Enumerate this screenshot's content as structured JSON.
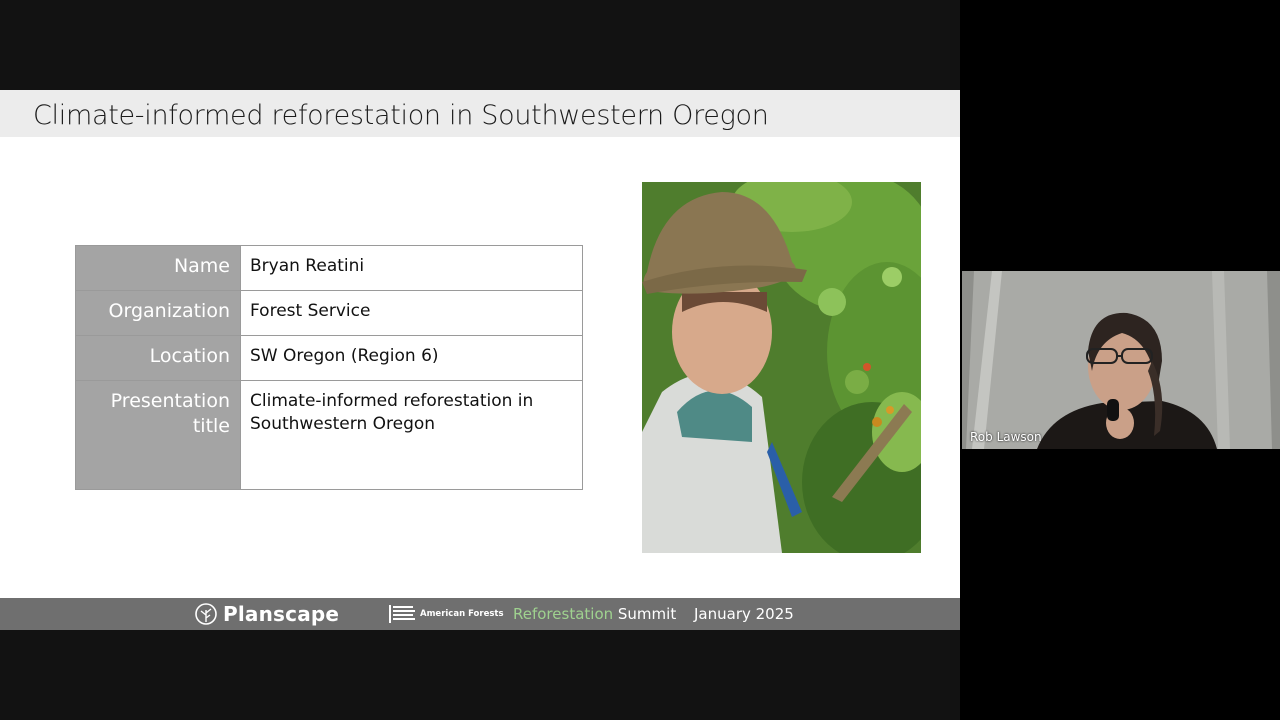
{
  "slide": {
    "title": "Climate-informed reforestation in Southwestern Oregon",
    "table": [
      {
        "key": "Name",
        "value": "Bryan Reatini"
      },
      {
        "key": "Organization",
        "value": "Forest Service"
      },
      {
        "key": "Location",
        "value": "SW Oregon (Region 6)"
      },
      {
        "key": "Presentation title",
        "value": "Climate-informed reforestation in Southwestern Oregon"
      }
    ],
    "photo_icon": "speaker-photo"
  },
  "footer": {
    "planscape_logo": "Planscape",
    "american_forests_logo": "American Forests",
    "summit_accent": "Reforestation",
    "summit_rest": " Summit",
    "date": "January 2025"
  },
  "participant": {
    "name": "Rob Lawson"
  },
  "colors": {
    "title_bar": "#ececec",
    "label_cell": "#a4a4a4",
    "footer": "#6f6f6f",
    "accent_green": "#9fd28f"
  }
}
